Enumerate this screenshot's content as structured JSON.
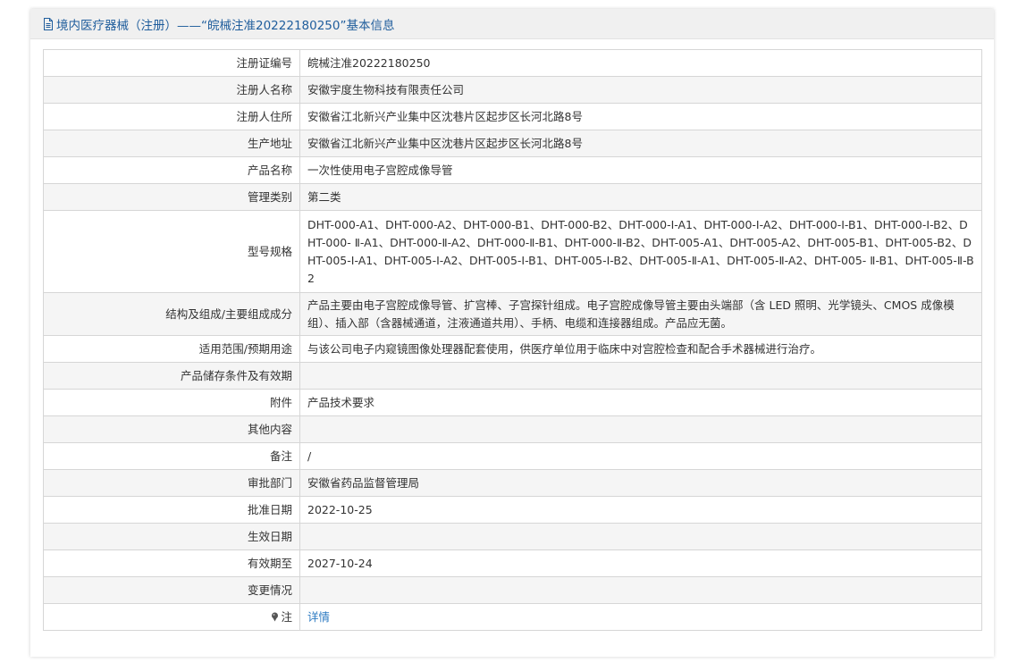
{
  "header": {
    "title": "境内医疗器械（注册）——“皖械注准20222180250”基本信息",
    "icon": "document-icon"
  },
  "rows": [
    {
      "label": "注册证编号",
      "value": "皖械注准20222180250"
    },
    {
      "label": "注册人名称",
      "value": "安徽宇度生物科技有限责任公司"
    },
    {
      "label": "注册人住所",
      "value": "安徽省江北新兴产业集中区沈巷片区起步区长河北路8号"
    },
    {
      "label": "生产地址",
      "value": "安徽省江北新兴产业集中区沈巷片区起步区长河北路8号"
    },
    {
      "label": "产品名称",
      "value": "一次性使用电子宫腔成像导管"
    },
    {
      "label": "管理类别",
      "value": "第二类"
    },
    {
      "label": "型号规格",
      "value": "DHT-000-A1、DHT-000-A2、DHT-000-B1、DHT-000-B2、DHT-000-I-A1、DHT-000-I-A2、DHT-000-I-B1、DHT-000-I-B2、DHT-000- Ⅱ-A1、DHT-000-Ⅱ-A2、DHT-000-Ⅱ-B1、DHT-000-Ⅱ-B2、DHT-005-A1、DHT-005-A2、DHT-005-B1、DHT-005-B2、DHT-005-I-A1、DHT-005-I-A2、DHT-005-I-B1、DHT-005-I-B2、DHT-005-Ⅱ-A1、DHT-005-Ⅱ-A2、DHT-005- Ⅱ-B1、DHT-005-Ⅱ-B2"
    },
    {
      "label": "结构及组成/主要组成成分",
      "value": "产品主要由电子宫腔成像导管、扩宫棒、子宫探针组成。电子宫腔成像导管主要由头端部（含 LED 照明、光学镜头、CMOS 成像模组）、插入部（含器械通道，注液通道共用）、手柄、电缆和连接器组成。产品应无菌。"
    },
    {
      "label": "适用范围/预期用途",
      "value": "与该公司电子内窥镜图像处理器配套使用，供医疗单位用于临床中对宫腔检查和配合手术器械进行治疗。"
    },
    {
      "label": "产品储存条件及有效期",
      "value": ""
    },
    {
      "label": "附件",
      "value": "产品技术要求"
    },
    {
      "label": "其他内容",
      "value": ""
    },
    {
      "label": "备注",
      "value": "/"
    },
    {
      "label": "审批部门",
      "value": "安徽省药品监督管理局"
    },
    {
      "label": "批准日期",
      "value": "2022-10-25"
    },
    {
      "label": "生效日期",
      "value": ""
    },
    {
      "label": "有效期至",
      "value": "2027-10-24"
    },
    {
      "label": "变更情况",
      "value": ""
    }
  ],
  "note_row": {
    "label": "注",
    "icon": "pin-icon",
    "link": "详情"
  },
  "colors": {
    "header_text": "#1f5d9c",
    "link": "#2b7ac1",
    "row_alt": "#f5f5f5",
    "border": "#d6d6d6"
  }
}
